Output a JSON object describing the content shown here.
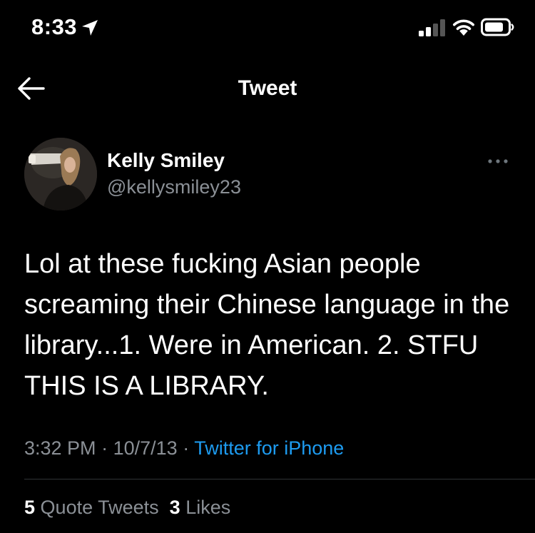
{
  "status_bar": {
    "time": "8:33"
  },
  "nav": {
    "title": "Tweet"
  },
  "tweet": {
    "author_name": "Kelly Smiley",
    "author_handle": "@kellysmiley23",
    "text": "Lol at these fucking Asian people screaming their Chinese language in the library...1. Were in American. 2. STFU THIS IS A LIBRARY.",
    "time": "3:32 PM",
    "date": "10/7/13",
    "separator": "·",
    "source": "Twitter for iPhone",
    "quote_tweets_count": "5",
    "quote_tweets_label": "Quote Tweets",
    "likes_count": "3",
    "likes_label": "Likes"
  },
  "colors": {
    "background": "#000000",
    "text": "#ffffff",
    "secondary_text": "#8b9096",
    "link": "#1d9bf0",
    "divider": "#2f3336"
  }
}
